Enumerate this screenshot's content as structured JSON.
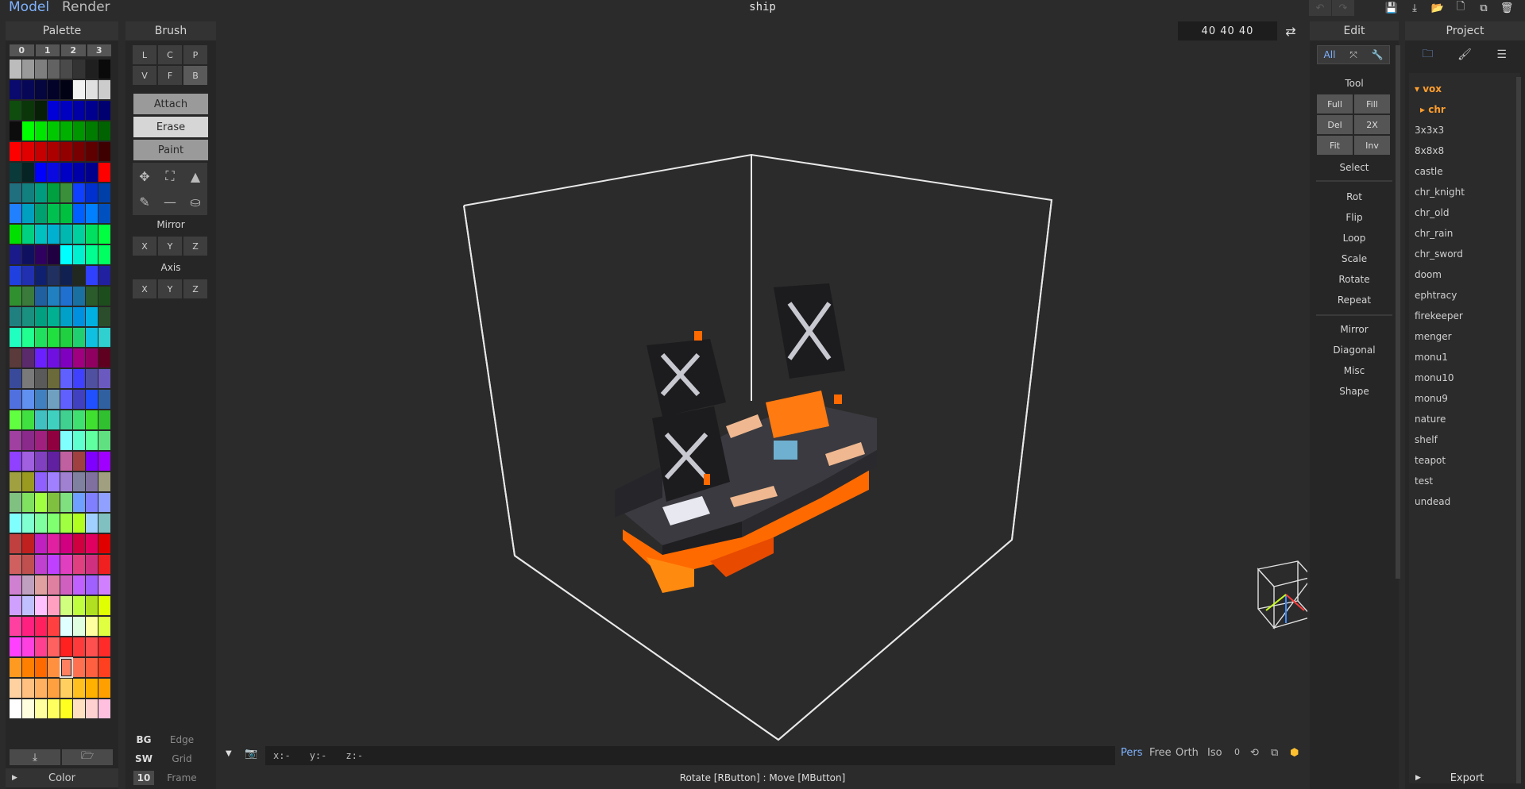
{
  "topbar": {
    "tabs": [
      "Model",
      "Render"
    ],
    "title": "ship",
    "actions": [
      {
        "icon": "undo-icon",
        "glyph": "↶"
      },
      {
        "icon": "redo-icon",
        "glyph": "↷"
      },
      {
        "icon": "save-icon",
        "glyph": "💾"
      },
      {
        "icon": "import-icon",
        "glyph": "⤓"
      },
      {
        "icon": "open-folder-icon",
        "glyph": "📂"
      },
      {
        "icon": "new-file-icon",
        "glyph": "🗋"
      },
      {
        "icon": "copy-icon",
        "glyph": "⧉"
      },
      {
        "icon": "trash-icon",
        "glyph": "🗑"
      }
    ]
  },
  "palette": {
    "title": "Palette",
    "tabs": [
      "0",
      "1",
      "2",
      "3"
    ],
    "footer": "Color",
    "selected_index": 236,
    "swatches": [
      "#bcbcbc",
      "#9a9a9a",
      "#7e7e7e",
      "#626262",
      "#4a4a4a",
      "#333333",
      "#1f1f1f",
      "#0a0a0a",
      "#0a0a6e",
      "#070757",
      "#050540",
      "#03032a",
      "#020215",
      "#f2f2f2",
      "#e0e0e0",
      "#cccccc",
      "#0e4d0e",
      "#0a360a",
      "#061f06",
      "#0000d8",
      "#0000c0",
      "#0000a6",
      "#00008e",
      "#000070",
      "#0c0c0c",
      "#00ff00",
      "#00e600",
      "#00c800",
      "#00b000",
      "#009600",
      "#007c00",
      "#006200",
      "#ff0000",
      "#e00000",
      "#c60000",
      "#ac0000",
      "#920000",
      "#780000",
      "#5e0000",
      "#3e0000",
      "#0a3a3a",
      "#062424",
      "#0000ff",
      "#0a0ae0",
      "#0000c4",
      "#0000a8",
      "#00008c",
      "#ff0000",
      "#1f6f7f",
      "#138080",
      "#009c80",
      "#00a040",
      "#3a8f3a",
      "#1040ff",
      "#0030d0",
      "#003fa8",
      "#2080ff",
      "#00a0c0",
      "#00a070",
      "#00c050",
      "#00c040",
      "#0060ff",
      "#0080ff",
      "#0050c0",
      "#00e000",
      "#00d080",
      "#00c0c0",
      "#00b0d0",
      "#00b8b0",
      "#00d0a0",
      "#00e060",
      "#00ff40",
      "#1a1a8a",
      "#101060",
      "#300060",
      "#200040",
      "#00ffff",
      "#00f0d0",
      "#00ff90",
      "#00ff60",
      "#2040e0",
      "#2030b0",
      "#102070",
      "#203060",
      "#102050",
      "#202820",
      "#3040ff",
      "#2020a0",
      "#309030",
      "#3a7a3a",
      "#2060a0",
      "#2080c0",
      "#2070d0",
      "#1a70a0",
      "#2b5a2b",
      "#1d4d1d",
      "#208080",
      "#1a9080",
      "#00a080",
      "#00b090",
      "#00a0c8",
      "#0090e0",
      "#00b0e0",
      "#2b4d2b",
      "#20ffc0",
      "#20ff90",
      "#20e060",
      "#20e040",
      "#20d040",
      "#20d070",
      "#10c0e0",
      "#30d0d0",
      "#5a3a3a",
      "#5a2a6a",
      "#6a20ff",
      "#7010e0",
      "#8000c0",
      "#a00080",
      "#900060",
      "#600020",
      "#3a4a9a",
      "#7a7a7a",
      "#5a5a5a",
      "#6a6a3a",
      "#6060ff",
      "#4040ff",
      "#5050a0",
      "#6a5ac0",
      "#5070e0",
      "#6090f0",
      "#4080c0",
      "#70a0c0",
      "#6060ff",
      "#4040c0",
      "#2050ff",
      "#3060a0",
      "#60ff40",
      "#40e040",
      "#40c0c0",
      "#40d0c0",
      "#40d090",
      "#40e070",
      "#40e030",
      "#30c030",
      "#a040a0",
      "#8a2a8a",
      "#a02080",
      "#900040",
      "#80ffff",
      "#60ffd0",
      "#60ffa0",
      "#60e080",
      "#9040ff",
      "#a060e0",
      "#8040c0",
      "#6020a0",
      "#c060a0",
      "#a04040",
      "#8000ff",
      "#a000ff",
      "#a0a040",
      "#9a9a20",
      "#9060ff",
      "#a080ff",
      "#a080d0",
      "#8080a0",
      "#8070a0",
      "#a0a080",
      "#80c080",
      "#80e060",
      "#a0ff40",
      "#80c040",
      "#80e080",
      "#70a0ff",
      "#8080ff",
      "#90a0ff",
      "#80ffff",
      "#80ffd0",
      "#80ffa0",
      "#80ff70",
      "#a0ff40",
      "#b0ff20",
      "#a0d0ff",
      "#80c0c0",
      "#c04040",
      "#c02020",
      "#c020c0",
      "#e020a0",
      "#d00080",
      "#d00040",
      "#e00060",
      "#e00000",
      "#d06060",
      "#c05050",
      "#c040d0",
      "#c040ff",
      "#e040c0",
      "#e04080",
      "#d03080",
      "#f02020",
      "#d080d0",
      "#c0a0c0",
      "#e0a0a0",
      "#e080a0",
      "#d060c0",
      "#c060ff",
      "#a060ff",
      "#d080ff",
      "#d0a0ff",
      "#c0c0ff",
      "#ffc0ff",
      "#ffa0c0",
      "#d0ff80",
      "#c0ff40",
      "#b0e020",
      "#e0ff00",
      "#ff40a0",
      "#ff2080",
      "#ff2060",
      "#ff4040",
      "#e0ffff",
      "#e0ffe0",
      "#ffffa0",
      "#e0ff40",
      "#ff40ff",
      "#ff40e0",
      "#ff4090",
      "#ff6060",
      "#ff2020",
      "#ff3a3a",
      "#ff5050",
      "#ff2a2a",
      "#ff9a20",
      "#ff8000",
      "#ff6a00",
      "#ff9040",
      "#ff8060",
      "#ff7050",
      "#ff6040",
      "#ff4020",
      "#ffd0a0",
      "#ffc080",
      "#ffb060",
      "#ffa040",
      "#ffd060",
      "#ffc020",
      "#ffb000",
      "#ffa000",
      "#ffffff",
      "#ffffe0",
      "#ffffa0",
      "#ffff60",
      "#ffff20",
      "#ffe0c0",
      "#ffd0d0",
      "#ffc0e0"
    ]
  },
  "brush": {
    "title": "Brush",
    "modes": [
      "L",
      "C",
      "P",
      "V",
      "F",
      "B"
    ],
    "active_mode": "B",
    "actions": [
      "Attach",
      "Erase",
      "Paint"
    ],
    "tools": [
      {
        "icon": "move-icon",
        "glyph": "✥"
      },
      {
        "icon": "select-rect-icon",
        "glyph": "⛶"
      },
      {
        "icon": "pointer-icon",
        "glyph": "▲"
      },
      {
        "icon": "eyedropper-icon",
        "glyph": "✎"
      },
      {
        "icon": "line-icon",
        "glyph": "—"
      },
      {
        "icon": "fill-bucket-icon",
        "glyph": "⛀"
      }
    ],
    "mirror_label": "Mirror",
    "mirror": [
      "X",
      "Y",
      "Z"
    ],
    "axis_label": "Axis",
    "axis": [
      "X",
      "Y",
      "Z"
    ],
    "bottom": [
      {
        "key": "BG",
        "value": "Edge"
      },
      {
        "key": "SW",
        "value": "Grid"
      },
      {
        "key": "10",
        "value": "Frame"
      }
    ]
  },
  "viewport": {
    "dims": "40  40  40",
    "coords": {
      "x": "x:-",
      "y": "y:-",
      "z": "z:-"
    },
    "view_modes": [
      "Pers",
      "Free",
      "Orth",
      "Iso"
    ],
    "active_view": "Pers",
    "counter": "0",
    "status": "Rotate [RButton] : Move [MButton]"
  },
  "edit": {
    "title": "Edit",
    "tabs": [
      {
        "label": "All",
        "icon": ""
      },
      {
        "label": "",
        "icon": "expand-icon",
        "glyph": "⤧"
      },
      {
        "label": "",
        "icon": "wrench-icon",
        "glyph": "🔧"
      }
    ],
    "tool_label": "Tool",
    "tool_buttons": [
      "Full",
      "Fill",
      "Del",
      "2X",
      "Fit",
      "Inv"
    ],
    "select_label": "Select",
    "ops": [
      "Rot",
      "Flip",
      "Loop",
      "Scale",
      "Rotate",
      "Repeat"
    ],
    "misc": [
      "Mirror",
      "Diagonal",
      "Misc",
      "Shape"
    ]
  },
  "project": {
    "title": "Project",
    "tabs": [
      {
        "icon": "folder-icon",
        "glyph": "🗀"
      },
      {
        "icon": "brush-icon",
        "glyph": "🖌"
      },
      {
        "icon": "list-icon",
        "glyph": "☰"
      }
    ],
    "folders": [
      "vox",
      "chr"
    ],
    "files": [
      "3x3x3",
      "8x8x8",
      "castle",
      "chr_knight",
      "chr_old",
      "chr_rain",
      "chr_sword",
      "doom",
      "ephtracy",
      "firekeeper",
      "menger",
      "monu1",
      "monu10",
      "monu9",
      "nature",
      "shelf",
      "teapot",
      "test",
      "undead"
    ],
    "footer": "Export"
  }
}
